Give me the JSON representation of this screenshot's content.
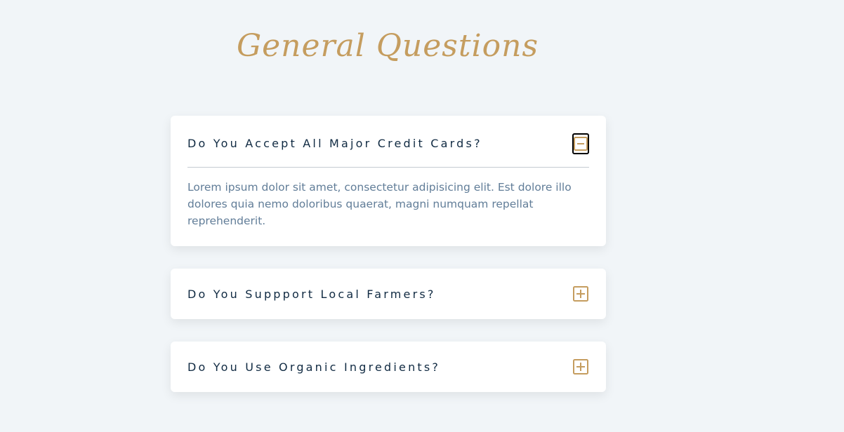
{
  "header": {
    "title": "General Questions"
  },
  "questions": [
    {
      "title": "Do You Accept All Major Credit Cards?",
      "answer": "Lorem ipsum dolor sit amet, consectetur adipisicing elit. Est dolore illo dolores quia nemo doloribus quaerat, magni numquam repellat reprehenderit.",
      "expanded": true,
      "toggle_icon": "minus-square-icon"
    },
    {
      "title": "Do You Suppport Local Farmers?",
      "expanded": false,
      "toggle_icon": "plus-square-icon"
    },
    {
      "title": "Do You Use Organic Ingredients?",
      "expanded": false,
      "toggle_icon": "plus-square-icon"
    }
  ],
  "colors": {
    "accent": "#c59d5f",
    "background": "#f1f5f8",
    "title_text": "#102a42",
    "body_text": "#617d98"
  }
}
